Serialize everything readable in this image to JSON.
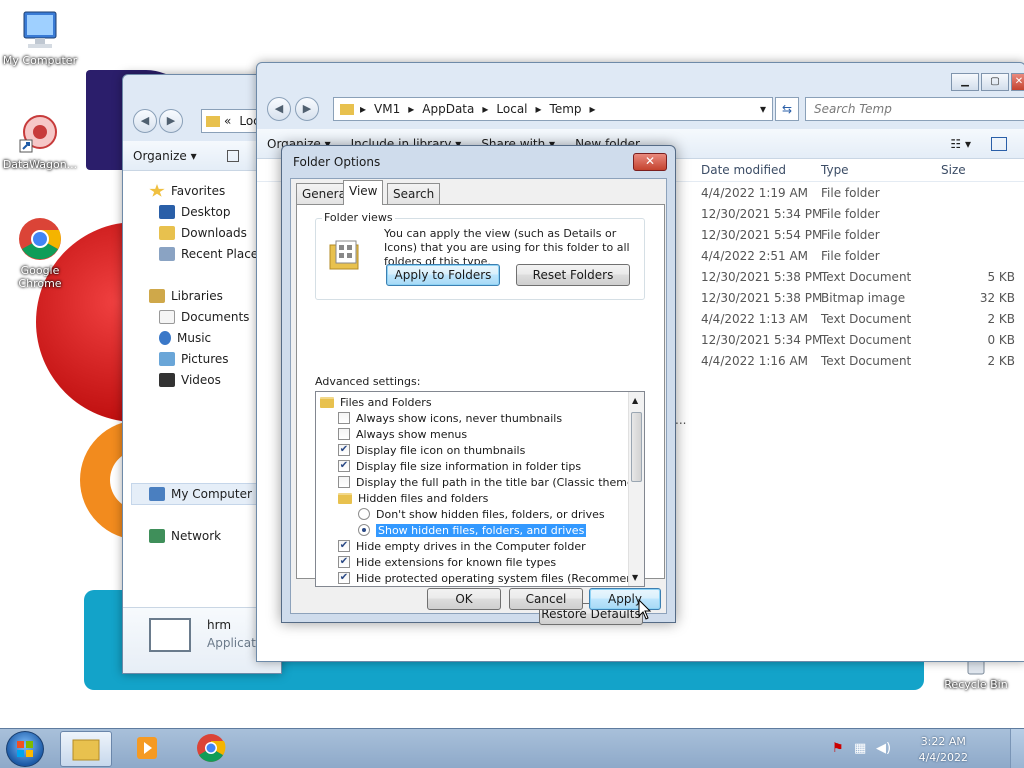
{
  "desktop": {
    "icons": [
      {
        "label": "My Computer"
      },
      {
        "label": "DataWagon..."
      },
      {
        "label": "Google Chrome"
      },
      {
        "label": "Recycle Bin"
      }
    ]
  },
  "back_window": {
    "address_crumb": "Loc",
    "toolbar_organize": "Organize ▾",
    "nav": {
      "favorites": "Favorites",
      "desktop": "Desktop",
      "downloads": "Downloads",
      "recent": "Recent Places",
      "libraries": "Libraries",
      "documents": "Documents",
      "music": "Music",
      "pictures": "Pictures",
      "videos": "Videos",
      "my_computer": "My Computer",
      "network": "Network"
    },
    "details_name": "hrm",
    "details_type": "Applicati"
  },
  "front_window": {
    "breadcrumb": [
      "VM1",
      "AppData",
      "Local",
      "Temp"
    ],
    "search_placeholder": "Search Temp",
    "toolbar": [
      "Organize ▾",
      "Include in library ▾",
      "Share with ▾",
      "New folder"
    ],
    "columns": {
      "date": "Date modified",
      "type": "Type",
      "size": "Size"
    },
    "rows": [
      {
        "date": "4/4/2022 1:19 AM",
        "type": "File folder",
        "size": ""
      },
      {
        "date": "12/30/2021 5:34 PM",
        "type": "File folder",
        "size": ""
      },
      {
        "date": "12/30/2021 5:54 PM",
        "type": "File folder",
        "size": ""
      },
      {
        "date": "4/4/2022 2:51 AM",
        "type": "File folder",
        "size": ""
      },
      {
        "date": "12/30/2021 5:38 PM",
        "type": "Text Document",
        "size": "5 KB"
      },
      {
        "date": "12/30/2021 5:38 PM",
        "type": "Bitmap image",
        "size": "32 KB"
      },
      {
        "date": "4/4/2022 1:13 AM",
        "type": "Text Document",
        "size": "2 KB"
      },
      {
        "date": "12/30/2021 5:34 PM",
        "type": "Text Document",
        "size": "0 KB"
      },
      {
        "date": "4/4/2022 1:16 AM",
        "type": "Text Document",
        "size": "2 KB"
      }
    ]
  },
  "dialog": {
    "title": "Folder Options",
    "close_label": "✕",
    "tabs": [
      "General",
      "View",
      "Search"
    ],
    "folder_views": {
      "label": "Folder views",
      "description": "You can apply the view (such as Details or Icons) that you are using for this folder to all folders of this type.",
      "apply_button": "Apply to Folders",
      "reset_button": "Reset Folders"
    },
    "advanced_label": "Advanced settings:",
    "advanced_items": [
      {
        "kind": "folder",
        "label": "Files and Folders",
        "checked": false
      },
      {
        "kind": "checkbox",
        "label": "Always show icons, never thumbnails",
        "checked": false
      },
      {
        "kind": "checkbox",
        "label": "Always show menus",
        "checked": false
      },
      {
        "kind": "checkbox",
        "label": "Display file icon on thumbnails",
        "checked": true
      },
      {
        "kind": "checkbox",
        "label": "Display file size information in folder tips",
        "checked": true
      },
      {
        "kind": "checkbox",
        "label": "Display the full path in the title bar (Classic theme only)",
        "checked": false
      },
      {
        "kind": "folder",
        "label": "Hidden files and folders",
        "checked": false
      },
      {
        "kind": "radio",
        "label": "Don't show hidden files, folders, or drives",
        "checked": false
      },
      {
        "kind": "radio",
        "label": "Show hidden files, folders, and drives",
        "checked": true,
        "selected": true
      },
      {
        "kind": "checkbox",
        "label": "Hide empty drives in the Computer folder",
        "checked": true
      },
      {
        "kind": "checkbox",
        "label": "Hide extensions for known file types",
        "checked": true
      },
      {
        "kind": "checkbox",
        "label": "Hide protected operating system files (Recommended)",
        "checked": true
      }
    ],
    "restore_defaults": "Restore Defaults",
    "ok": "OK",
    "cancel": "Cancel",
    "apply": "Apply"
  },
  "taskbar": {
    "time": "3:22 AM",
    "date": "4/4/2022"
  },
  "colors": {
    "accent": "#3399ff",
    "title_bar": "#dfe9f5",
    "taskbar": "#9cb6d3"
  }
}
